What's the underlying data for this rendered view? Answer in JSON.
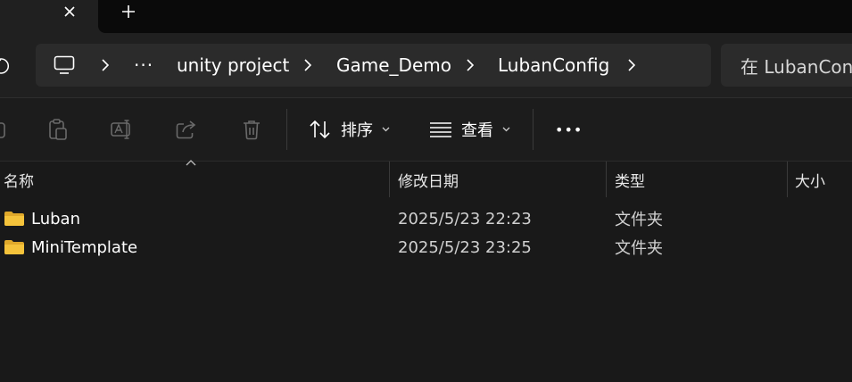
{
  "titlebar": {
    "close_icon": "close-icon",
    "new_tab_icon": "plus-icon"
  },
  "address": {
    "breadcrumb": [
      {
        "label": "unity project"
      },
      {
        "label": "Game_Demo"
      },
      {
        "label": "LubanConfig"
      }
    ],
    "more_glyph": "···",
    "search_placeholder": "在 LubanConfig 中搜索"
  },
  "toolbar": {
    "sort_label": "排序",
    "view_label": "查看",
    "more_glyph": "•••"
  },
  "columns": {
    "name": "名称",
    "date": "修改日期",
    "type": "类型",
    "size": "大小"
  },
  "files": [
    {
      "name": "Luban",
      "date": "2025/5/23 22:23",
      "type": "文件夹"
    },
    {
      "name": "MiniTemplate",
      "date": "2025/5/23 23:25",
      "type": "文件夹"
    }
  ],
  "colors": {
    "folder": "#f5c33b",
    "background": "#191919"
  }
}
